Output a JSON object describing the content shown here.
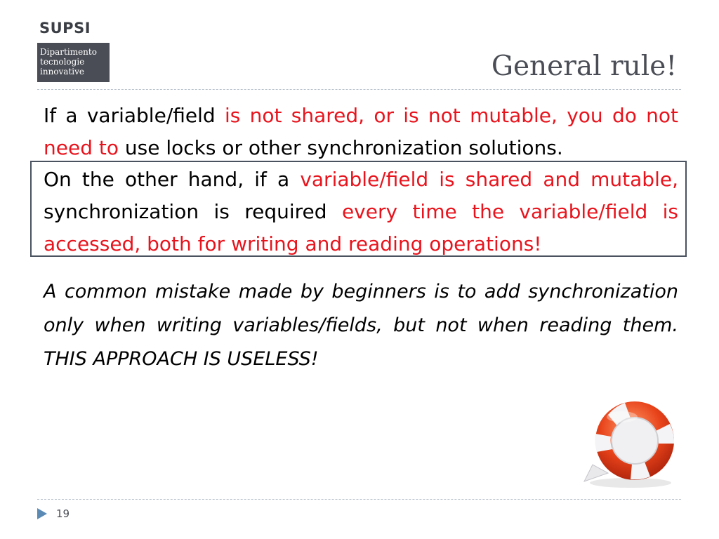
{
  "header": {
    "logo_text": "SUPSI",
    "department": [
      "Dipartimento",
      "tecnologie",
      "innovative"
    ]
  },
  "slide": {
    "title": "General rule!",
    "paragraph1": {
      "part1": "If a variable/field ",
      "part2_red": "is not shared, or is not mutable, you do not need to",
      "part3": " use locks or other synchronization solutions."
    },
    "paragraph2": {
      "part1": "On the other hand, if a ",
      "part2_red": "variable/field is shared and mutable,",
      "part3": " synchronization is required ",
      "part4_red": "every time the variable/field is accessed, both for writing and reading operations!"
    },
    "paragraph3": {
      "line": "A common mistake made by beginners is to add synchronization only when writing variables/fields, but not when reading them. THIS APPROACH IS USELESS!"
    }
  },
  "footer": {
    "page_number": "19"
  },
  "colors": {
    "accent_red": "#e8141d",
    "brand_gray": "#4a4d55",
    "footer_arrow": "#5b8bb5"
  },
  "icons": {
    "lifebuoy": "lifebuoy-icon",
    "footer_arrow": "triangle-right-icon"
  }
}
